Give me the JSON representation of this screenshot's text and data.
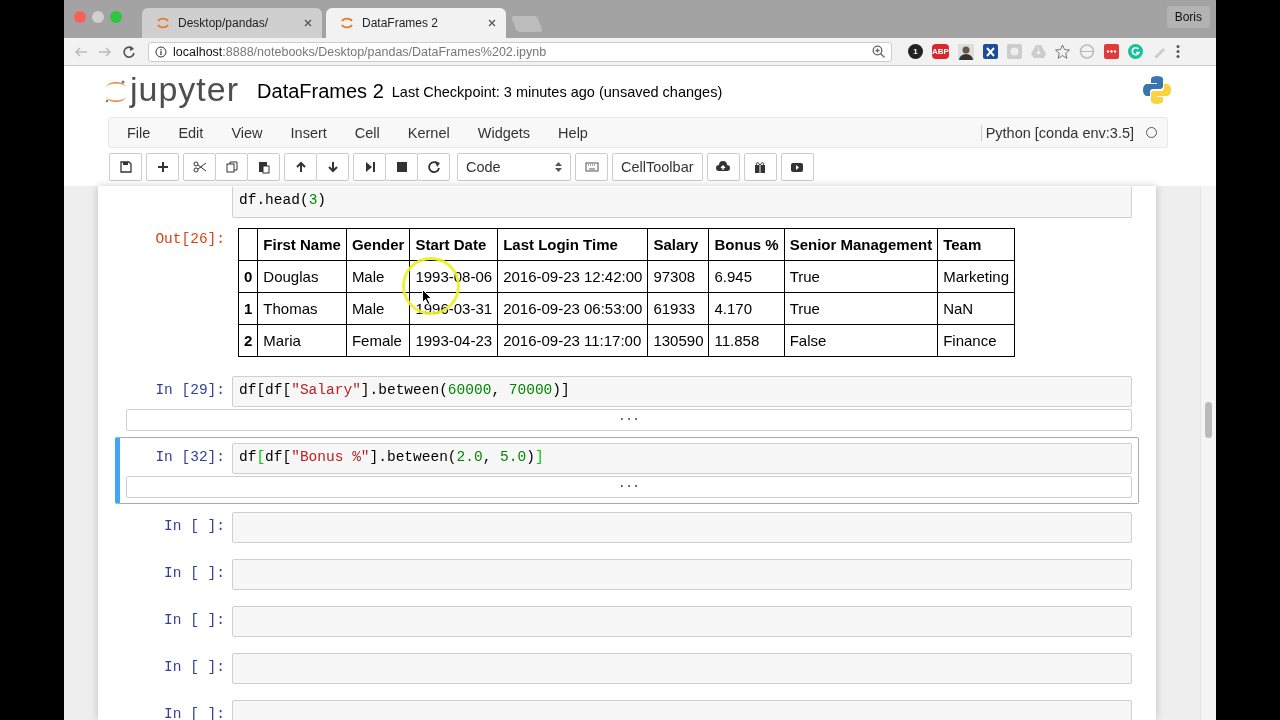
{
  "browser": {
    "tabs": [
      {
        "title": "Desktop/pandas/",
        "selected": false
      },
      {
        "title": "DataFrames 2",
        "selected": true
      }
    ],
    "profile": "Boris",
    "url_host": "localhost",
    "url_rest": ":8888/notebooks/Desktop/pandas/DataFrames%202.ipynb",
    "extension_badges": [
      "1",
      "ABP"
    ]
  },
  "notebook": {
    "logo": "jupyter",
    "title": "DataFrames 2",
    "checkpoint": "Last Checkpoint: 3 minutes ago (unsaved changes)",
    "menu": [
      "File",
      "Edit",
      "View",
      "Insert",
      "Cell",
      "Kernel",
      "Widgets",
      "Help"
    ],
    "kernel": "Python [conda env:3.5]",
    "cell_type": "Code",
    "celltoolbar": "CellToolbar"
  },
  "cells": [
    {
      "kind": "output",
      "selected": false,
      "code": [
        {
          "text": "df.head(",
          "kind": "plain"
        },
        {
          "text": "3",
          "kind": "number"
        },
        {
          "text": ")",
          "kind": "plain"
        }
      ],
      "out_prompt": "Out[26]:",
      "table": {
        "columns": [
          "First Name",
          "Gender",
          "Start Date",
          "Last Login Time",
          "Salary",
          "Bonus %",
          "Senior Management",
          "Team"
        ],
        "rows": [
          {
            "index": "0",
            "cells": [
              "Douglas",
              "Male",
              "1993-08-06",
              "2016-09-23 12:42:00",
              "97308",
              "6.945",
              "True",
              "Marketing"
            ]
          },
          {
            "index": "1",
            "cells": [
              "Thomas",
              "Male",
              "1996-03-31",
              "2016-09-23 06:53:00",
              "61933",
              "4.170",
              "True",
              "NaN"
            ]
          },
          {
            "index": "2",
            "cells": [
              "Maria",
              "Female",
              "1993-04-23",
              "2016-09-23 11:17:00",
              "130590",
              "11.858",
              "False",
              "Finance"
            ]
          }
        ]
      }
    },
    {
      "kind": "collapsed",
      "selected": false,
      "prompt": "In [29]:",
      "collapsed_text": "...",
      "code": [
        {
          "text": "df[df[",
          "kind": "plain"
        },
        {
          "text": "\"Salary\"",
          "kind": "string"
        },
        {
          "text": "].between(",
          "kind": "plain"
        },
        {
          "text": "60000",
          "kind": "number"
        },
        {
          "text": ", ",
          "kind": "plain"
        },
        {
          "text": "70000",
          "kind": "number"
        },
        {
          "text": ")]",
          "kind": "plain"
        }
      ]
    },
    {
      "kind": "collapsed",
      "selected": true,
      "prompt": "In [32]:",
      "collapsed_text": "...",
      "code": [
        {
          "text": "df",
          "kind": "plain"
        },
        {
          "text": "[",
          "kind": "match"
        },
        {
          "text": "df[",
          "kind": "plain"
        },
        {
          "text": "\"Bonus %\"",
          "kind": "string"
        },
        {
          "text": "].between(",
          "kind": "plain"
        },
        {
          "text": "2.0",
          "kind": "number"
        },
        {
          "text": ", ",
          "kind": "plain"
        },
        {
          "text": "5.0",
          "kind": "number"
        },
        {
          "text": ")",
          "kind": "plain"
        },
        {
          "text": "]",
          "kind": "match"
        }
      ]
    },
    {
      "kind": "empty",
      "selected": false,
      "prompt": "In [ ]:"
    },
    {
      "kind": "empty",
      "selected": false,
      "prompt": "In [ ]:"
    },
    {
      "kind": "empty",
      "selected": false,
      "prompt": "In [ ]:"
    },
    {
      "kind": "empty",
      "selected": false,
      "prompt": "In [ ]:"
    },
    {
      "kind": "empty",
      "selected": false,
      "prompt": "In [ ]:"
    }
  ]
}
